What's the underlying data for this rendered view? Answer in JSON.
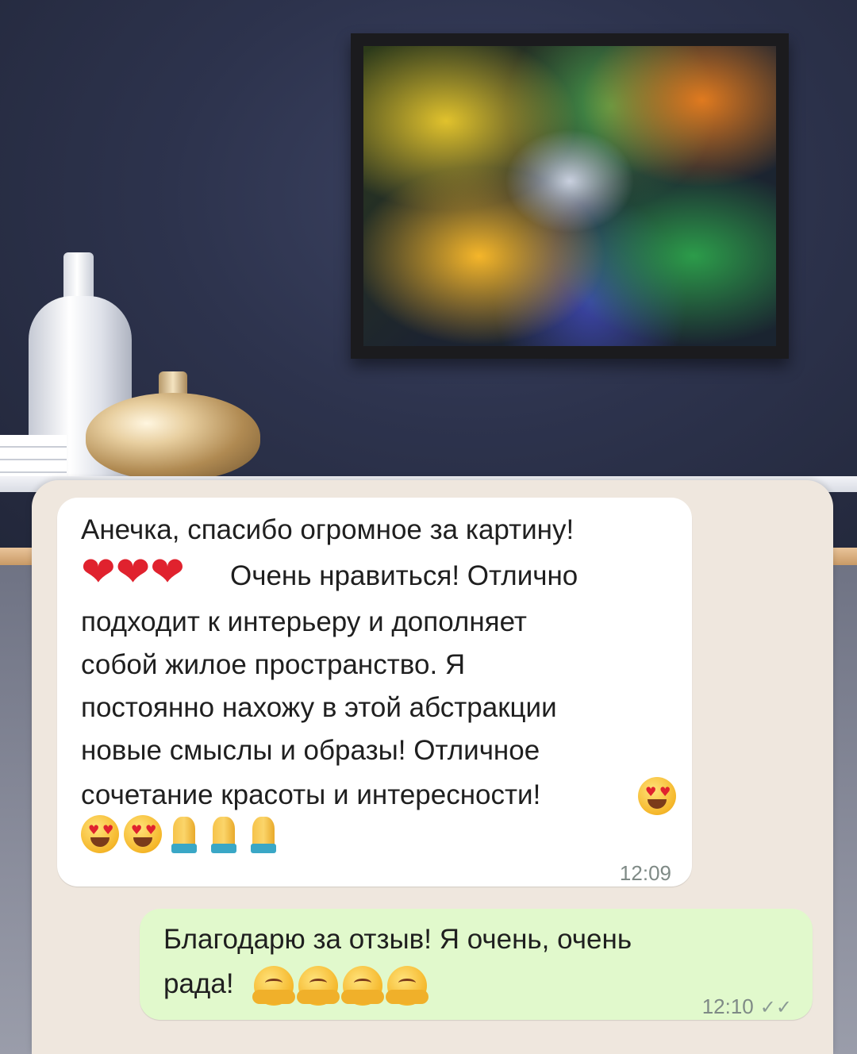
{
  "incoming": {
    "lines": [
      "Анечка, спасибо огромное за картину!",
      "Очень нравиться! Отлично",
      "подходит к интерьеру и дополняет",
      "собой жилое пространство. Я",
      "постоянно нахожу в этой абстракции",
      "новые смыслы и образы! Отличное",
      "сочетание красоты и интересности!"
    ],
    "time": "12:09",
    "emojis": [
      "red-heart",
      "red-heart",
      "red-heart",
      "heart-eyes-face",
      "heart-eyes-face",
      "heart-eyes-face",
      "folded-hands",
      "folded-hands",
      "folded-hands"
    ]
  },
  "outgoing": {
    "lines": [
      "Благодарю за отзыв! Я очень, очень",
      "рада!"
    ],
    "time": "12:10",
    "status_icon": "double-check-icon",
    "emojis": [
      "hugging-face",
      "hugging-face",
      "hugging-face",
      "hugging-face"
    ]
  },
  "colors": {
    "incoming_bubble": "#ffffff",
    "outgoing_bubble": "#e1f9cc",
    "chat_background": "#efe7de"
  }
}
